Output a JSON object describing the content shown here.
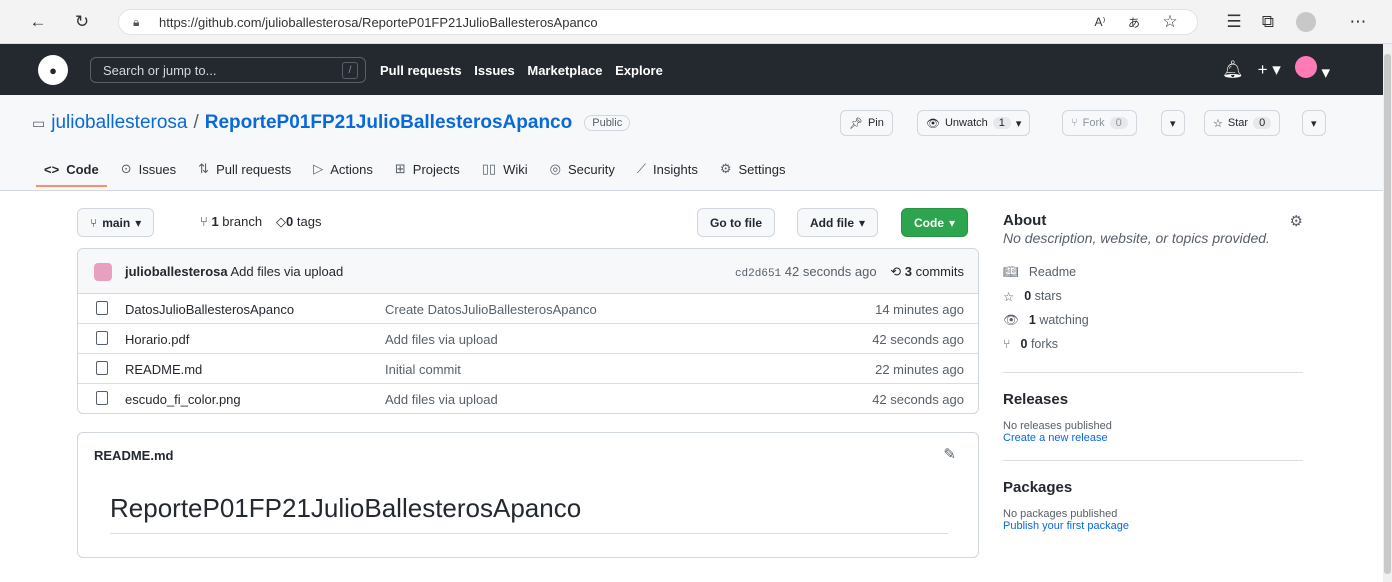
{
  "browser": {
    "url": "https://github.com/julioballesterosa/ReporteP01FP21JulioBallesterosApanco"
  },
  "header": {
    "search_placeholder": "Search or jump to...",
    "slash_key": "/",
    "nav": [
      "Pull requests",
      "Issues",
      "Marketplace",
      "Explore"
    ]
  },
  "repo": {
    "owner": "julioballesterosa",
    "separator": "/",
    "name": "ReporteP01FP21JulioBallesterosApanco",
    "visibility": "Public",
    "pin_label": "Pin",
    "unwatch_label": "Unwatch",
    "watch_count": "1",
    "fork_label": "Fork",
    "fork_count": "0",
    "star_label": "Star",
    "star_count": "0"
  },
  "tabs": [
    {
      "icon": "code-icon",
      "label": "Code"
    },
    {
      "icon": "issues-icon",
      "label": "Issues"
    },
    {
      "icon": "pull-request-icon",
      "label": "Pull requests"
    },
    {
      "icon": "actions-icon",
      "label": "Actions"
    },
    {
      "icon": "projects-icon",
      "label": "Projects"
    },
    {
      "icon": "wiki-icon",
      "label": "Wiki"
    },
    {
      "icon": "security-icon",
      "label": "Security"
    },
    {
      "icon": "insights-icon",
      "label": "Insights"
    },
    {
      "icon": "settings-icon",
      "label": "Settings"
    }
  ],
  "toolbar": {
    "branch": "main",
    "branch_count": "1",
    "branch_text": "branch",
    "tag_count": "0",
    "tag_text": "tags",
    "go_to_file": "Go to file",
    "add_file": "Add file",
    "code": "Code"
  },
  "latest_commit": {
    "author": "julioballesterosa",
    "message": "Add files via upload",
    "sha": "cd2d651",
    "time": "42 seconds ago",
    "commits_count": "3",
    "commits_text": "commits"
  },
  "files": [
    {
      "name": "DatosJulioBallesterosApanco",
      "message": "Create DatosJulioBallesterosApanco",
      "time": "14 minutes ago"
    },
    {
      "name": "Horario.pdf",
      "message": "Add files via upload",
      "time": "42 seconds ago"
    },
    {
      "name": "README.md",
      "message": "Initial commit",
      "time": "22 minutes ago"
    },
    {
      "name": "escudo_fi_color.png",
      "message": "Add files via upload",
      "time": "42 seconds ago"
    }
  ],
  "readme": {
    "filename": "README.md",
    "heading": "ReporteP01FP21JulioBallesterosApanco"
  },
  "about": {
    "title": "About",
    "description": "No description, website, or topics provided.",
    "readme": "Readme",
    "stars_count": "0",
    "stars_text": "stars",
    "watching_count": "1",
    "watching_text": "watching",
    "forks_count": "0",
    "forks_text": "forks"
  },
  "releases": {
    "title": "Releases",
    "none": "No releases published",
    "link": "Create a new release"
  },
  "packages": {
    "title": "Packages",
    "none": "No packages published",
    "link": "Publish your first package"
  },
  "colors": {
    "header_bg": "#24292f",
    "link": "#0969da",
    "code_button": "#2da44e",
    "tab_underline": "#fd8c73"
  }
}
